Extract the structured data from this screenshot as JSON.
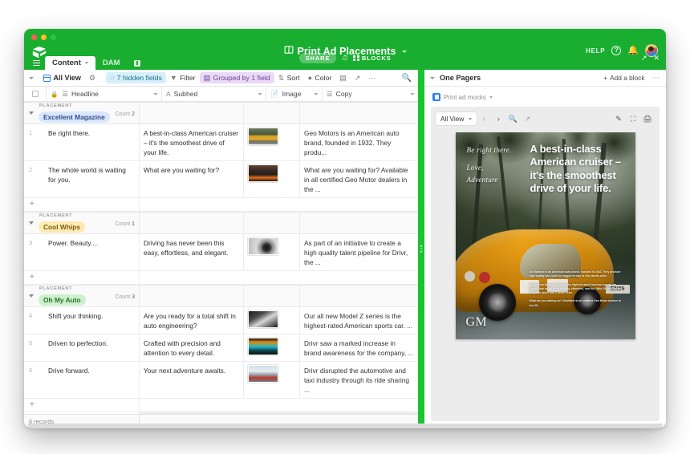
{
  "window": {
    "traffic_lights": [
      "close",
      "minimize",
      "maximize"
    ]
  },
  "header": {
    "doc_title": "Print Ad Placements",
    "doc_icon": "book-icon",
    "help_label": "HELP",
    "help_icon": "question-circle-icon",
    "bell_icon": "bell-icon",
    "avatar": "user-avatar",
    "share_label": "SHARE",
    "history_icon": "history-clock-icon",
    "blocks_label": "BLOCKS",
    "expand_icon": "expand-icon",
    "close_icon": "close-icon",
    "tabs": [
      {
        "label": "Content",
        "active": true
      },
      {
        "label": "DAM",
        "active": false
      }
    ],
    "add_tab_icon": "add-tab-icon",
    "menu_icon": "hamburger-icon"
  },
  "toolbar": {
    "view_caret": "chevron-down-icon",
    "view_name": "All View",
    "collaborators_icon": "collaborators-icon",
    "hidden_fields": "7 hidden fields",
    "hidden_fields_icon": "eye-off-icon",
    "filter": "Filter",
    "filter_icon": "filter-icon",
    "group": "Grouped by 1 field",
    "group_icon": "group-icon",
    "sort": "Sort",
    "sort_icon": "sort-icon",
    "color": "Color",
    "color_icon": "paint-icon",
    "row_height_icon": "row-height-icon",
    "share_view_icon": "share-view-icon",
    "more_icon": "more-horizontal-icon",
    "search_icon": "search-icon"
  },
  "grid": {
    "columns": [
      {
        "label": "Headline",
        "icon": "long-text-icon",
        "locked": true
      },
      {
        "label": "Subhed",
        "icon": "text-a-icon"
      },
      {
        "label": "Image",
        "icon": "attachment-icon"
      },
      {
        "label": "Copy",
        "icon": "long-text-icon"
      }
    ],
    "select_all_checkbox": "unchecked",
    "groups": [
      {
        "field_label": "PLACEMENT",
        "value": "Excellent Magazine",
        "count_label": "Count",
        "count": "2",
        "pill_color": "#dbe7ff",
        "rows": [
          {
            "num": "1",
            "headline": "Be right there.",
            "subhed": "A best-in-class American cruiser – it's the smoothest drive of your life.",
            "image": "yellow-sports-car-thumbnail",
            "copy": "Geo Motors is an American auto brand, founded in 1932. They produ..."
          },
          {
            "num": "2",
            "headline": "The whole world is waiting for you.",
            "subhed": "What are you waiting for?",
            "image": "orange-car-storefront-thumbnail",
            "copy": "What are you waiting for? Available in all certified Geo Motor dealers in the ..."
          }
        ],
        "add_row_icon": "plus-icon"
      },
      {
        "field_label": "PLACEMENT",
        "value": "Cool Whips",
        "count_label": "Count",
        "count": "1",
        "pill_color": "#ffeab0",
        "rows": [
          {
            "num": "3",
            "headline": "Power. Beauty....",
            "subhed": "Driving has never been this easy, effortless, and elegant.",
            "image": "white-car-wheel-thumbnail",
            "copy": "As part of an initiative to create a high quality talent pipeline for Drivr, the ..."
          }
        ],
        "add_row_icon": "plus-icon"
      },
      {
        "field_label": "PLACEMENT",
        "value": "Oh My Auto",
        "count_label": "Count",
        "count": "3",
        "pill_color": "#cdf1cd",
        "rows": [
          {
            "num": "4",
            "headline": "Shift your thinking.",
            "subhed": "Are you ready for a total shift in auto engineering?",
            "image": "gearshift-bw-thumbnail",
            "copy": "Our all new Model Z series is the highest-rated American sports car. ..."
          },
          {
            "num": "5",
            "headline": "Driven to perfection.",
            "subhed": "Crafted with precision and attention to every detail.",
            "image": "car-dashboard-thumbnail",
            "copy": "Drivr saw a marked increase in brand awareness for the company, ..."
          },
          {
            "num": "6",
            "headline": "Drive forward.",
            "subhed": "Your next adventure awaits.",
            "image": "lounge-interior-thumbnail",
            "copy": "Drivr disrupted the automotive and taxi industry through its ride sharing ..."
          }
        ],
        "add_row_icon": "plus-icon"
      }
    ],
    "footer": "6 records"
  },
  "block_pane": {
    "title": "One Pagers",
    "collapse_icon": "chevron-down-icon",
    "add_block": "Add a block",
    "add_block_icon": "plus-icon",
    "more_icon": "more-horizontal-icon",
    "breadcrumb": {
      "icon": "document-block-icon",
      "label": "Print ad mocks",
      "caret": "chevron-down-icon"
    },
    "preview_toolbar": {
      "view_select": "All View",
      "prev_icon": "chevron-left-icon",
      "next_icon": "chevron-right-icon",
      "zoom_icon": "search-icon",
      "fullscreen_icon": "expand-diagonal-icon",
      "edit_icon": "pencil-icon",
      "frame_icon": "frame-icon",
      "print_icon": "printer-icon"
    },
    "ad": {
      "script_line_1": "Be right there.",
      "script_line_2": "Love,",
      "script_line_3": "Adventure",
      "headline": "A best-in-class American cruiser – it's the smoothest drive of your life.",
      "body_1": "Geo Motors is an American auto brand, founded in 1932. They produce high quality cars built for rugged terrain or city streets alike.",
      "body_2": "Our all new Model Z series is the highest-rated American sports car. Driving has never been so easy, effortless, and fun. With 15 horsepower, 40 gallon tanks and 4 wheel drive.",
      "body_3": "What are you waiting for? Available in all certified Geo Motor dealers in the US.",
      "logo": "GM",
      "plate": "EN86"
    }
  }
}
